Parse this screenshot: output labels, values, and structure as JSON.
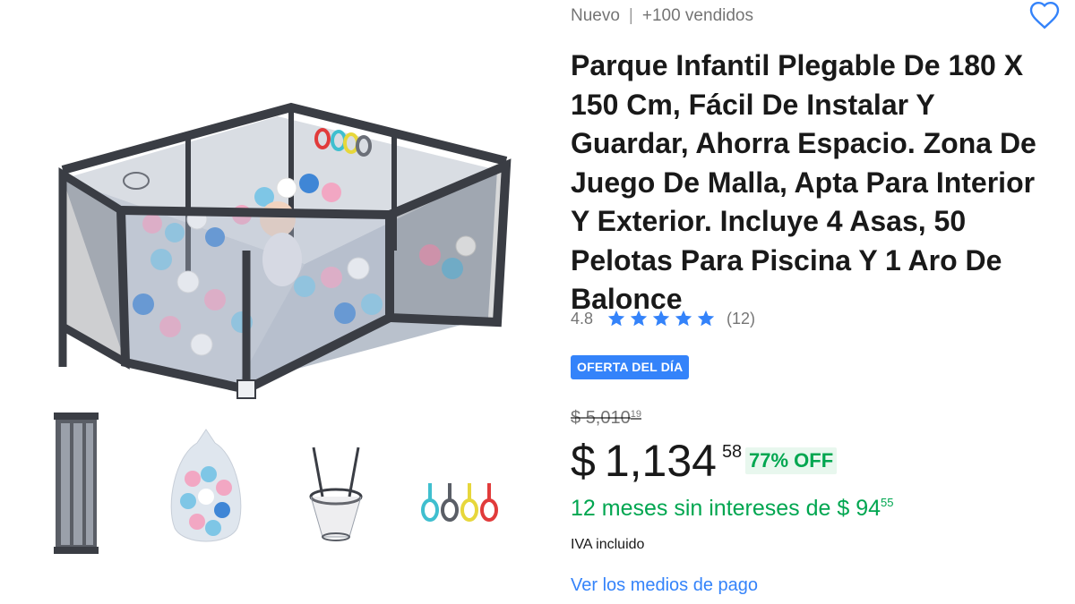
{
  "product": {
    "condition": "Nuevo",
    "separator": "|",
    "sold": "+100 vendidos",
    "title": "Parque Infantil Plegable De 180 X 150 Cm, Fácil De Instalar Y Guardar, Ahorra Espacio. Zona De Juego De Malla, Apta Para Interior Y Exterior. Incluye 4 Asas, 50 Pelotas Para Piscina Y 1 Aro De Balonce",
    "rating": {
      "value": "4.8",
      "count": "(12)",
      "stars": 5,
      "star_color": "#3483fa"
    },
    "badge": "OFERTA DEL DÍA",
    "old_price": {
      "currency": "$",
      "amount": "5,010",
      "cents": "19"
    },
    "price": {
      "currency": "$",
      "amount": "1,134",
      "cents": "58"
    },
    "discount": "77% OFF",
    "installments": {
      "text": "12 meses sin intereses de $ 94",
      "cents": "55"
    },
    "tax_note": "IVA incluido",
    "payment_link": "Ver los medios de pago"
  },
  "gallery": {
    "main_image": "playpen-with-balls",
    "thumbnails": [
      "folded-frame",
      "ball-bag",
      "basketball-hoop",
      "pull-rings"
    ]
  },
  "colors": {
    "accent": "#3483fa",
    "green": "#00a650"
  },
  "icons": {
    "favorite": "heart-icon",
    "star": "star-icon"
  }
}
